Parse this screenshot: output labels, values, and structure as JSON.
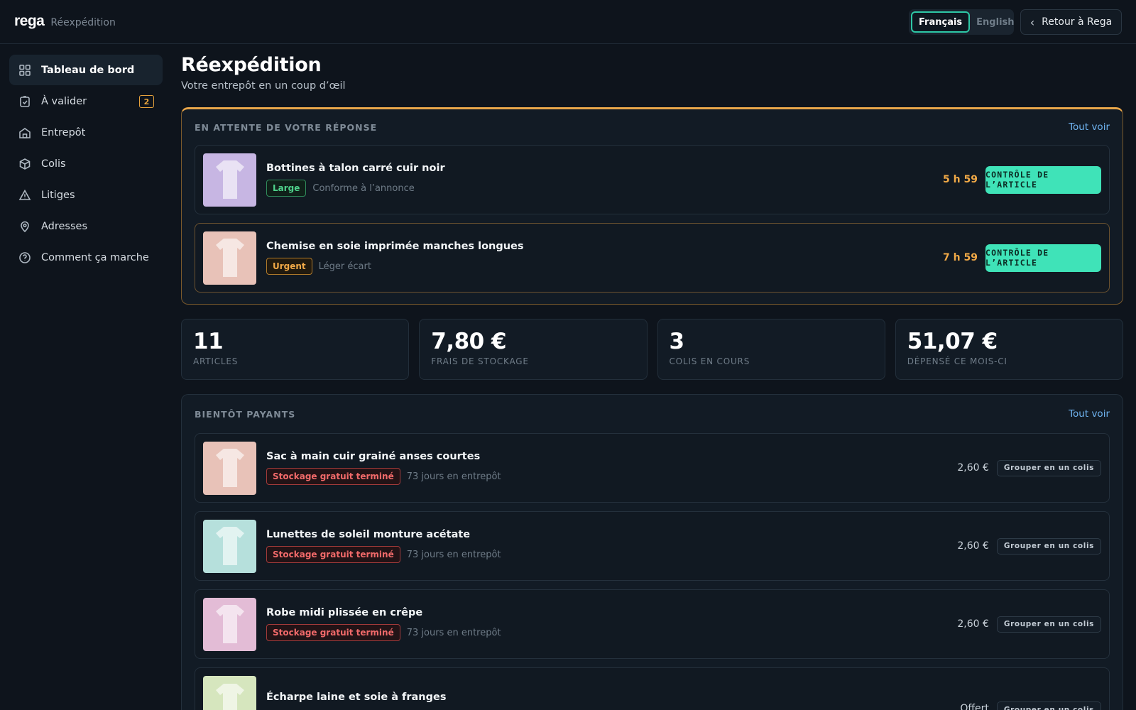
{
  "header": {
    "logo": "rega",
    "section": "Réexpédition",
    "languages": [
      {
        "label": "Français",
        "active": true
      },
      {
        "label": "English",
        "active": false
      }
    ],
    "back_label": "Retour à Rega"
  },
  "sidebar": {
    "items": [
      {
        "label": "Tableau de bord",
        "icon": "grid-icon",
        "active": true
      },
      {
        "label": "À valider",
        "icon": "clipboard-check-icon",
        "badge": "2"
      },
      {
        "label": "Entrepôt",
        "icon": "warehouse-icon"
      },
      {
        "label": "Colis",
        "icon": "package-icon"
      },
      {
        "label": "Litiges",
        "icon": "warning-icon"
      },
      {
        "label": "Adresses",
        "icon": "location-pin-icon"
      },
      {
        "label": "Comment ça marche",
        "icon": "help-circle-icon"
      }
    ]
  },
  "main": {
    "title": "Réexpédition",
    "subtitle": "Votre entrepôt en un coup d’œil",
    "pending": {
      "title": "EN ATTENTE DE VOTRE RÉPONSE",
      "link": "Tout voir",
      "items": [
        {
          "name": "Bottines à talon carré cuir noir",
          "tag": "Large",
          "tag_style": "green",
          "note": "Conforme à l’annonce",
          "timer": "5 h 59",
          "action": "CONTRÔLE DE L’ARTICLE",
          "thumb_color": "#c7b6e3"
        },
        {
          "name": "Chemise en soie imprimée manches longues",
          "tag": "Urgent",
          "tag_style": "amber",
          "note": "Léger écart",
          "timer": "7 h 59",
          "action": "CONTRÔLE DE L’ARTICLE",
          "thumb_color": "#e8c2b8"
        }
      ]
    },
    "stats": [
      {
        "value": "11",
        "label": "ARTICLES"
      },
      {
        "value": "7,80 €",
        "label": "FRAIS DE STOCKAGE"
      },
      {
        "value": "3",
        "label": "COLIS EN COURS"
      },
      {
        "value": "51,07 €",
        "label": "DÉPENSÉ CE MOIS-CI"
      }
    ],
    "soon_paid": {
      "title": "BIENTÔT PAYANTS",
      "link": "Tout voir",
      "items": [
        {
          "name": "Sac à main cuir grainé anses courtes",
          "tag": "Stockage gratuit terminé",
          "note": "73 jours en entrepôt",
          "price": "2,60 €",
          "action": "Grouper en un colis",
          "thumb_color": "#e8c2b8"
        },
        {
          "name": "Lunettes de soleil monture acétate",
          "tag": "Stockage gratuit terminé",
          "note": "73 jours en entrepôt",
          "price": "2,60 €",
          "action": "Grouper en un colis",
          "thumb_color": "#b6e0dc"
        },
        {
          "name": "Robe midi plissée en crêpe",
          "tag": "Stockage gratuit terminé",
          "note": "73 jours en entrepôt",
          "price": "2,60 €",
          "action": "Grouper en un colis",
          "thumb_color": "#e3bcd6"
        },
        {
          "name": "Écharpe laine et soie à franges",
          "tag": "",
          "note": "",
          "price": "Offert",
          "action": "Grouper en un colis",
          "thumb_color": "#d6e6be"
        }
      ]
    }
  }
}
